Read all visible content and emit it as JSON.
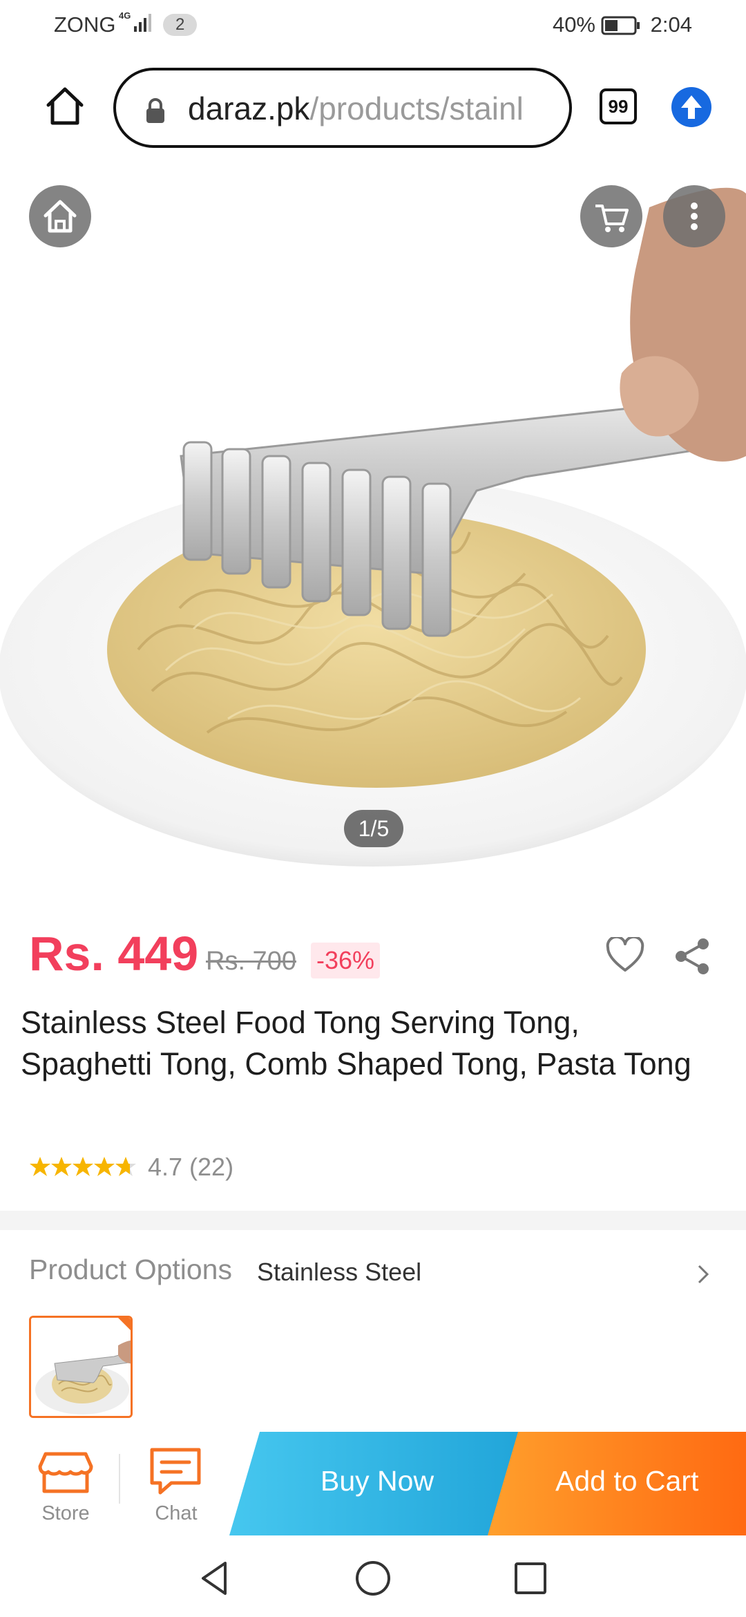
{
  "status_bar": {
    "carrier": "ZONG",
    "network": "4G",
    "sim_count": "2",
    "battery": "40%",
    "time": "2:04"
  },
  "browser": {
    "url_domain": "daraz.pk",
    "url_path": "/products/stainl",
    "tab_count": "99",
    "icons": [
      "home-icon",
      "lock-icon",
      "tabs-icon",
      "upload-icon"
    ]
  },
  "gallery": {
    "indicator": "1/5",
    "icons": [
      "home-icon",
      "cart-icon",
      "more-vertical-icon"
    ]
  },
  "product": {
    "price": "Rs. 449",
    "original_price": "Rs. 700",
    "discount": "-36%",
    "title": "Stainless Steel Food Tong Serving Tong, Spaghetti Tong, Comb Shaped Tong, Pasta Tong",
    "rating_text": "4.7 (22)",
    "rating_value": 4.7,
    "review_count": 22
  },
  "options": {
    "label": "Product Options",
    "value": "Stainless Steel"
  },
  "actions": {
    "store_label": "Store",
    "chat_label": "Chat",
    "buy_now_label": "Buy Now",
    "add_to_cart_label": "Add to Cart"
  },
  "colors": {
    "price_red": "#f23f5c",
    "accent_orange": "#f57224",
    "buy_now_blue": "#1fa3d8",
    "add_cart_orange": "#ff6a12",
    "upload_blue": "#1769e0"
  }
}
